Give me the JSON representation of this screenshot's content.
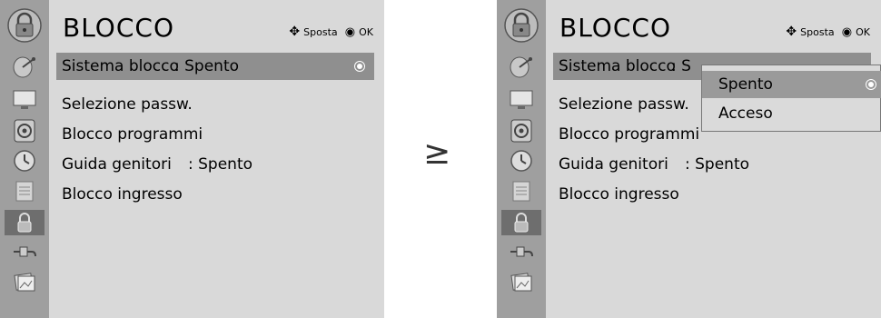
{
  "left_menu": {
    "title": "BLOCCO",
    "hint_move": "Sposta",
    "hint_ok": "OK",
    "items": [
      {
        "label": "Sistema blocco",
        "value": ": Spento"
      },
      {
        "label": "Selezione passw.",
        "value": ""
      },
      {
        "label": "Blocco programmi",
        "value": ""
      },
      {
        "label": "Guida genitori",
        "value": ": Spento"
      },
      {
        "label": "Blocco ingresso",
        "value": ""
      }
    ]
  },
  "right_menu": {
    "title": "BLOCCO",
    "hint_move": "Sposta",
    "hint_ok": "OK",
    "items": [
      {
        "label": "Sistema blocco",
        "value": ": S"
      },
      {
        "label": "Selezione passw.",
        "value": ""
      },
      {
        "label": "Blocco programmi",
        "value": ""
      },
      {
        "label": "Guida genitori",
        "value": ": Spento"
      },
      {
        "label": "Blocco ingresso",
        "value": ""
      }
    ],
    "popup": {
      "options": [
        "Spento",
        "Acceso"
      ],
      "selected": "Spento"
    }
  },
  "transition_symbol": "≥",
  "sidebar_icons": [
    "lock-header-icon",
    "satellite-dish-icon",
    "tv-screen-icon",
    "speaker-icon",
    "clock-icon",
    "calendar-icon",
    "lock-icon",
    "plug-icon",
    "photo-icon"
  ],
  "colors": {
    "sidebar": "#9f9f9f",
    "main": "#d9d9d9",
    "highlight": "#8f8f8f",
    "selected_icon": "#6e6e6e"
  }
}
